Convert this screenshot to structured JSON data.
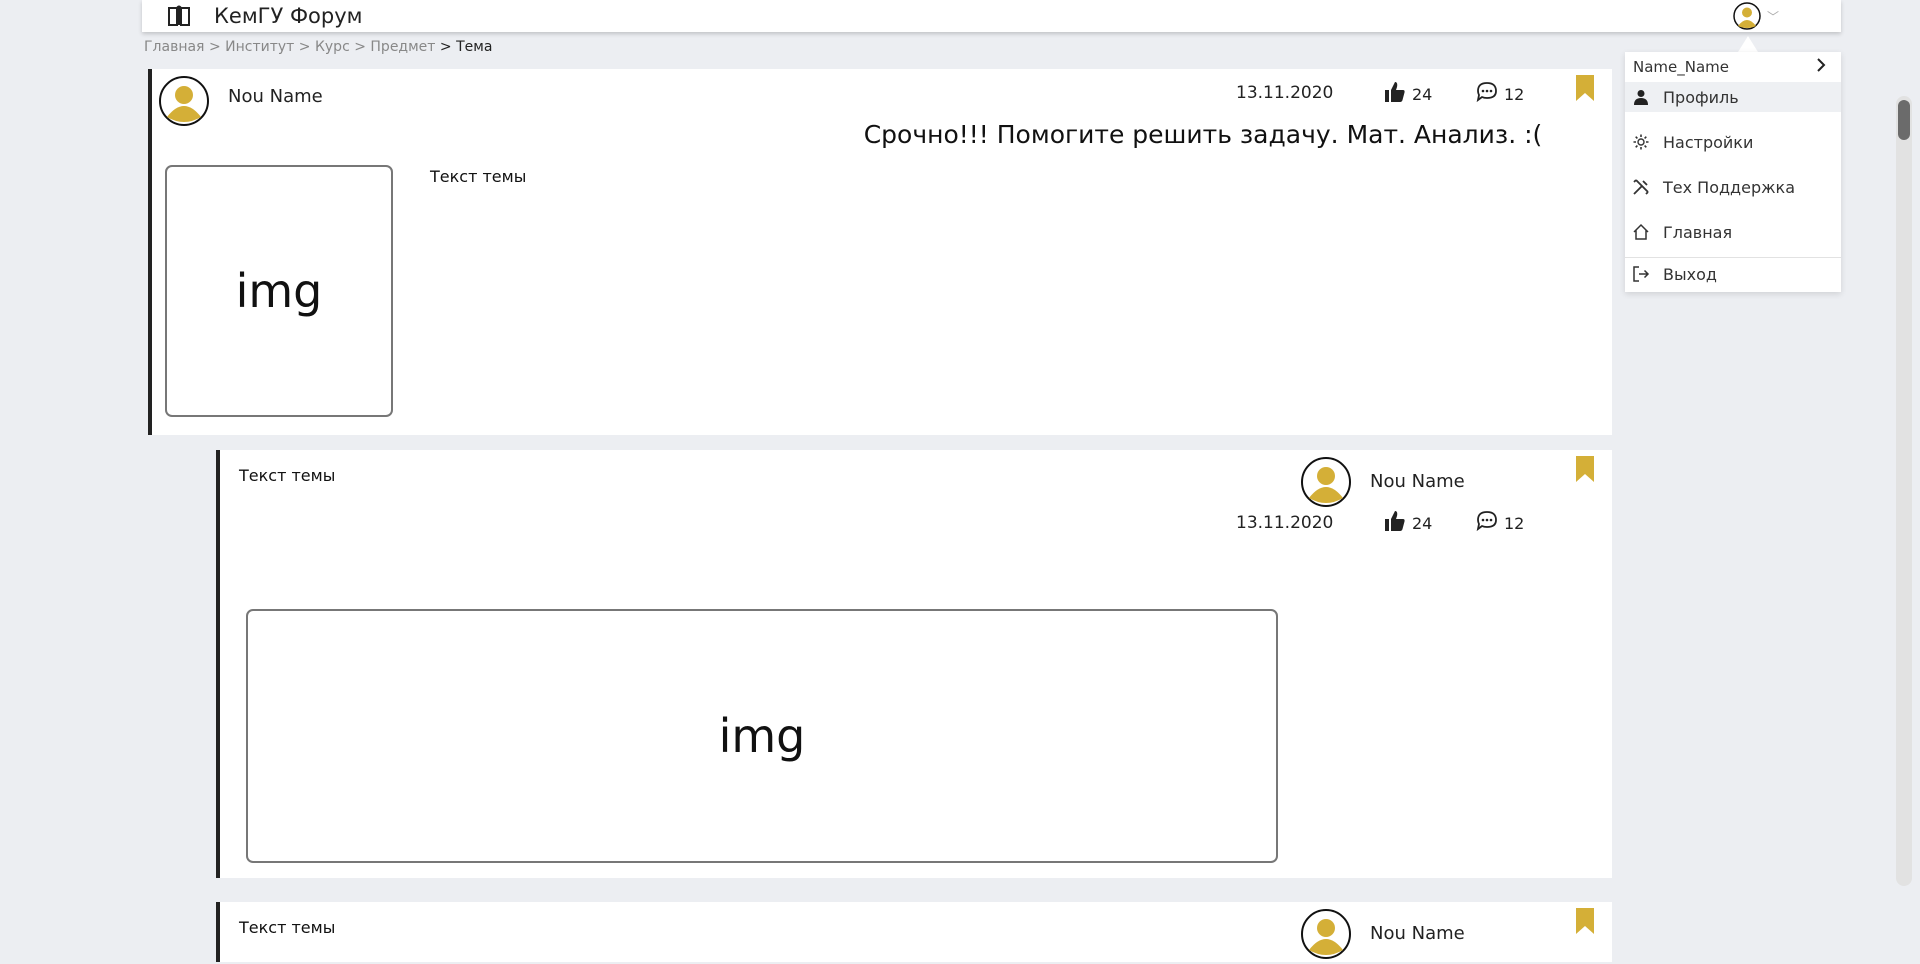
{
  "header": {
    "app_title": "КемГУ Форум",
    "logo_icon": "book-icon",
    "avatar_icon": "user-avatar-icon",
    "chevron_icon": "chevron-down-icon"
  },
  "breadcrumb": {
    "items": [
      "Главная",
      "Институт",
      "Курс",
      "Предмет"
    ],
    "current": "Тема",
    "separator": ">"
  },
  "post": {
    "author": "Nou Name",
    "date": "13.11.2020",
    "likes": "24",
    "comments": "12",
    "title": "Срочно!!! Помогите решить задачу. Мат. Анализ. :(",
    "body_text": "Текст темы",
    "image_label": "img"
  },
  "replies": [
    {
      "text": "Текст темы",
      "author": "Nou Name",
      "date": "13.11.2020",
      "likes": "24",
      "comments": "12",
      "image_label": "img"
    },
    {
      "text": "Текст темы",
      "author": "Nou Name"
    }
  ],
  "user_menu": {
    "username": "Name_Name",
    "items": [
      {
        "label": "Профиль",
        "icon": "person-icon",
        "highlighted": true
      },
      {
        "label": "Настройки",
        "icon": "gear-icon",
        "highlighted": false
      },
      {
        "label": "Тех Поддержка",
        "icon": "tools-icon",
        "highlighted": false
      },
      {
        "label": "Главная",
        "icon": "home-icon",
        "highlighted": false
      },
      {
        "label": "Выход",
        "icon": "logout-icon",
        "highlighted": false
      }
    ]
  },
  "colors": {
    "accent": "#d4af37",
    "background": "#eceef2",
    "card": "#ffffff",
    "card_border": "#222222"
  }
}
